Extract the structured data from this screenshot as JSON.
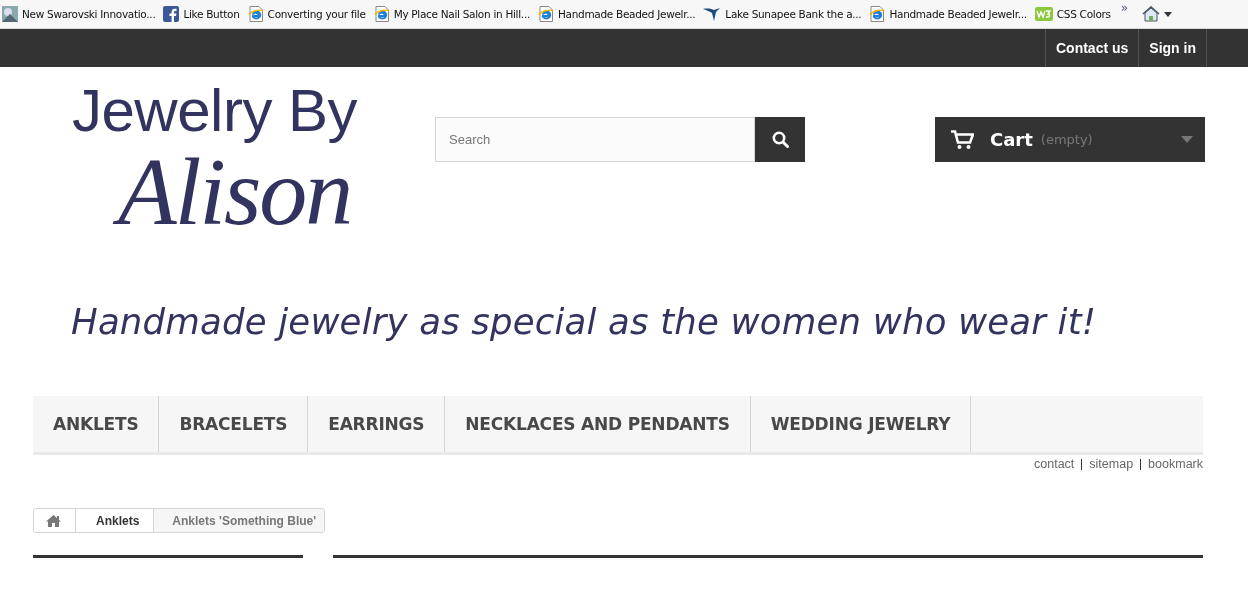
{
  "bookmarks": [
    {
      "label": "New Swarovski Innovatio...",
      "kind": "photo"
    },
    {
      "label": "Like Button",
      "kind": "facebook"
    },
    {
      "label": "Converting your file",
      "kind": "page"
    },
    {
      "label": "My Place Nail Salon in Hill...",
      "kind": "page"
    },
    {
      "label": "Handmade Beaded Jewelr...",
      "kind": "page"
    },
    {
      "label": "Lake Sunapee Bank  the a...",
      "kind": "bird"
    },
    {
      "label": "Handmade Beaded Jewelr...",
      "kind": "page"
    },
    {
      "label": "CSS Colors",
      "kind": "w3"
    }
  ],
  "bookmarks_more": "»",
  "top_nav": [
    "Contact us",
    "Sign in"
  ],
  "logo": {
    "line_1": "Jewelry By",
    "line_2": "Alison"
  },
  "search": {
    "placeholder": "Search"
  },
  "cart": {
    "label": "Cart",
    "status": "(empty)"
  },
  "tagline": "Handmade jewelry as special as the women who wear it!",
  "menu": [
    "ANKLETS",
    "BRACELETS",
    "EARRINGS",
    "NECKLACES AND PENDANTS",
    "WEDDING JEWELRY"
  ],
  "utility_links": [
    "contact",
    "sitemap",
    "bookmark"
  ],
  "breadcrumb": [
    "Anklets",
    "Anklets 'Something Blue'"
  ]
}
